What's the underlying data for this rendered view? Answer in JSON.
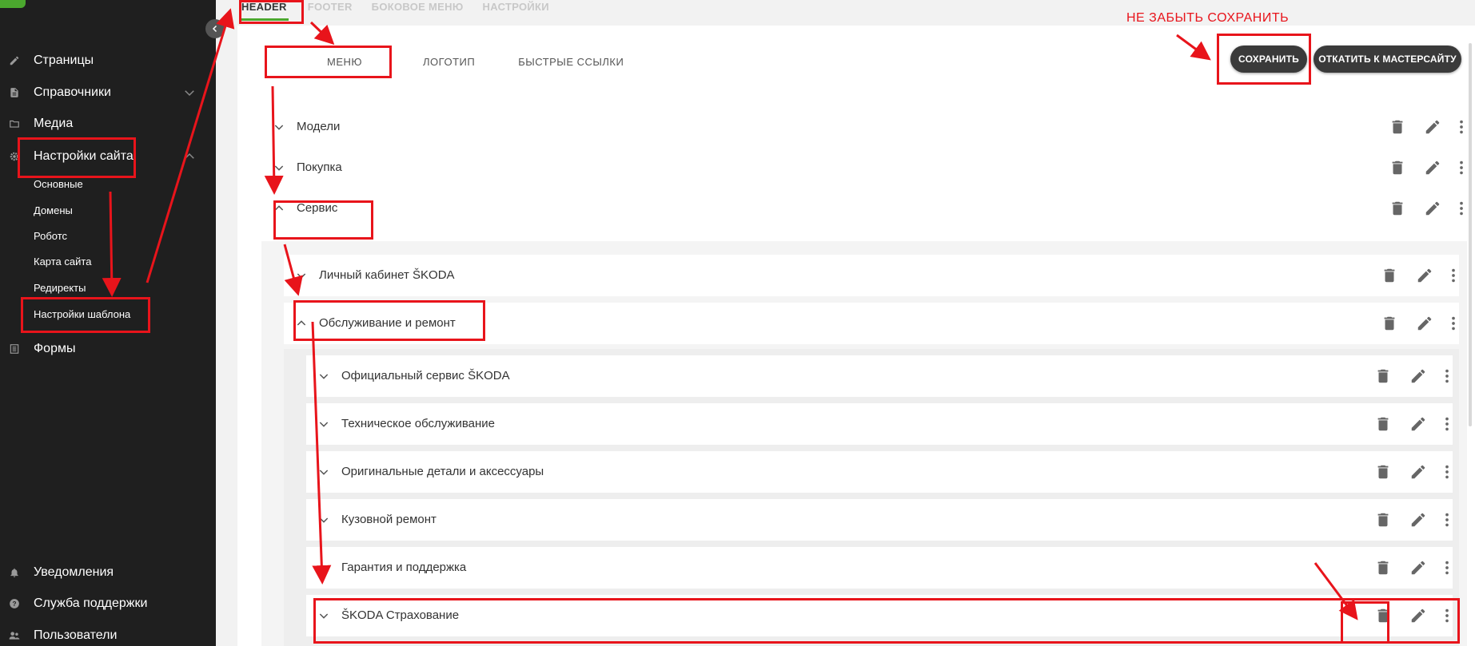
{
  "sidebar": {
    "items": [
      {
        "label": "Страницы",
        "icon": "pencil-icon"
      },
      {
        "label": "Справочники",
        "icon": "document-icon"
      },
      {
        "label": "Медиа",
        "icon": "folder-icon"
      },
      {
        "label": "Настройки сайта",
        "icon": "gear-icon"
      },
      {
        "label": "Формы",
        "icon": "list-icon"
      }
    ],
    "subitems": [
      "Основные",
      "Домены",
      "Роботс",
      "Карта сайта",
      "Редиректы",
      "Настройки шаблона"
    ],
    "bottom_items": [
      {
        "label": "Уведомления",
        "icon": "bell-icon"
      },
      {
        "label": "Служба поддержки",
        "icon": "help-icon"
      },
      {
        "label": "Пользователи",
        "icon": "users-icon"
      }
    ]
  },
  "top_tabs": [
    "HEADER",
    "FOOTER",
    "БОКОВОЕ МЕНЮ",
    "НАСТРОЙКИ"
  ],
  "sub_tabs": [
    "МЕНЮ",
    "ЛОГОТИП",
    "БЫСТРЫЕ ССЫЛКИ"
  ],
  "buttons": {
    "save": "СОХРАНИТЬ",
    "rollback": "ОТКАТИТЬ К МАСТЕРСАЙТУ"
  },
  "menu_rows": [
    "Модели",
    "Покупка",
    "Сервис",
    "Личный кабинет ŠKODA",
    "Обслуживание и ремонт",
    "Официальный сервис ŠKODA",
    "Техническое обслуживание",
    "Оригинальные детали и аксессуары",
    "Кузовной ремонт",
    "Гарантия и поддержка",
    "ŠKODA Страхование"
  ],
  "annotation": {
    "note": "НЕ ЗАБЫТЬ СОХРАНИТЬ"
  },
  "colors": {
    "accent": "#4ba82e",
    "annotation": "#e8141b",
    "sidebar": "#1f1f1f",
    "button": "#3a3a3a"
  }
}
